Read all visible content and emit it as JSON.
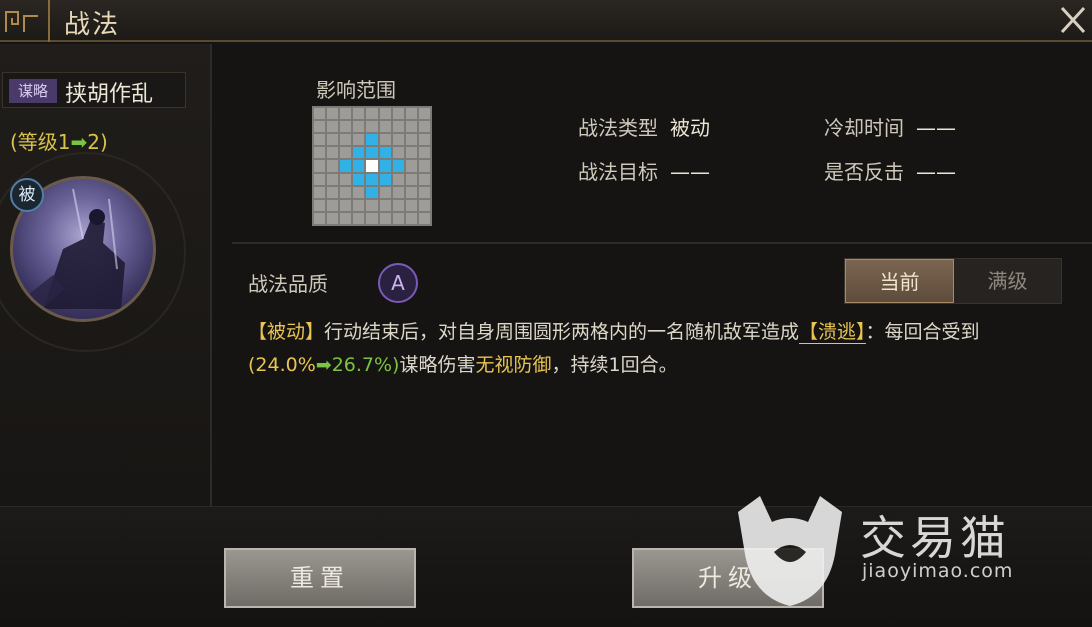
{
  "window": {
    "title": "战法",
    "close_icon": "close-icon"
  },
  "left": {
    "tag": "谋略",
    "skill_name": "挟胡作乱",
    "level": {
      "prefix": "(等级1",
      "arrow": "➡",
      "suffix": "2)"
    },
    "badge": "被"
  },
  "range": {
    "label": "影响范围",
    "grid_size": 9,
    "hit_cells": [
      [
        2,
        4
      ],
      [
        3,
        3
      ],
      [
        3,
        4
      ],
      [
        3,
        5
      ],
      [
        4,
        2
      ],
      [
        4,
        3
      ],
      [
        4,
        5
      ],
      [
        4,
        6
      ],
      [
        5,
        3
      ],
      [
        5,
        4
      ],
      [
        5,
        5
      ],
      [
        6,
        4
      ]
    ],
    "center": [
      4,
      4
    ]
  },
  "info": {
    "type_label": "战法类型",
    "type_value": "被动",
    "cooldown_label": "冷却时间",
    "cooldown_value": "——",
    "target_label": "战法目标",
    "target_value": "——",
    "counter_label": "是否反击",
    "counter_value": "——"
  },
  "quality": {
    "label": "战法品质",
    "grade": "A"
  },
  "toggle": {
    "current": "当前",
    "max": "满级"
  },
  "description": {
    "tag": "【被动】",
    "text1": "行动结束后，对自身周围圆形两格内的一名随机敌军造成",
    "status": "【溃逃】",
    "text2": "：每回合受到",
    "open_paren": "(24.0%",
    "arrow": "➡",
    "close_value": "26.7%)",
    "text3": "谋略伤害",
    "ignore_defense": "无视防御",
    "text4": "，持续1回合。"
  },
  "buttons": {
    "reset": "重置",
    "upgrade": "升级"
  },
  "watermark": {
    "cn": "交易猫",
    "en": "jiaoyimao.com"
  },
  "colors": {
    "accent_gold": "#e8c451",
    "accent_green": "#7ac443",
    "range_hit": "#32b1e6"
  }
}
